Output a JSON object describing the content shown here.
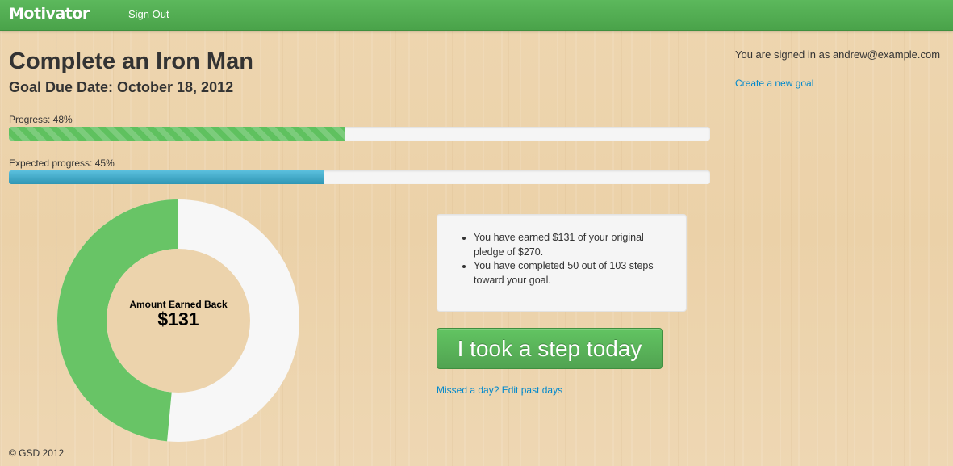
{
  "navbar": {
    "brand": "Motivator",
    "sign_out": "Sign Out"
  },
  "goal": {
    "title": "Complete an Iron Man",
    "due_date": "Goal Due Date: October 18, 2012"
  },
  "progress": {
    "label": "Progress: 48%",
    "value": 0.48,
    "color": "#5fc15f"
  },
  "expected_progress": {
    "label": "Expected progress: 45%",
    "value": 0.45,
    "color": "#3aa6cf"
  },
  "sidebar": {
    "signed_in": "You are signed in as andrew@example.com",
    "create_link": "Create a new goal"
  },
  "donut": {
    "caption": "Amount Earned Back",
    "value": "$131",
    "earned": 131,
    "pledge": 270,
    "earned_color": "#68c466",
    "remaining_color": "#f7f7f7"
  },
  "summary": {
    "items": [
      "You have earned $131 of your original pledge of $270.",
      "You have completed 50 out of 103 steps toward your goal."
    ]
  },
  "step_button": {
    "label": "I took a step today"
  },
  "missed_link": "Missed a day? Edit past days",
  "footer": "© GSD 2012"
}
